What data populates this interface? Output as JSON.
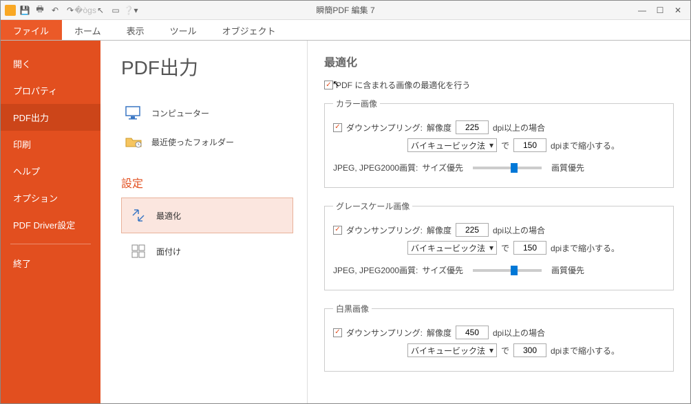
{
  "title": "瞬簡PDF 編集 7",
  "menu": {
    "file": "ファイル",
    "home": "ホーム",
    "view": "表示",
    "tool": "ツール",
    "object": "オブジェクト"
  },
  "sidebar": [
    "開く",
    "プロパティ",
    "PDF出力",
    "印刷",
    "ヘルプ",
    "オプション",
    "PDF Driver設定",
    "終了"
  ],
  "page": {
    "title": "PDF出力",
    "nav": {
      "computer": "コンピューター",
      "recent": "最近使ったフォルダー"
    },
    "settings_hdr": "設定",
    "opt_optimize": "最適化",
    "opt_impose": "面付け"
  },
  "optimize": {
    "heading": "最適化",
    "chk_main": "PDF に含まれる画像の最適化を行う",
    "grp_color": "カラー画像",
    "grp_gray": "グレースケール画像",
    "grp_bw": "白黒画像",
    "lbl_down": "ダウンサンプリング:",
    "lbl_res": "解像度",
    "lbl_dpi_over": "dpi以上の場合",
    "lbl_method": "バイキュービック法",
    "lbl_de": "で",
    "lbl_dpi_shrink": "dpiまで縮小する。",
    "lbl_jpeg": "JPEG, JPEG2000画質:",
    "lbl_size_pri": "サイズ優先",
    "lbl_qual_pri": "画質優先",
    "color_res": "225",
    "color_to": "150",
    "gray_res": "225",
    "gray_to": "150",
    "bw_res": "450",
    "bw_to": "300"
  }
}
